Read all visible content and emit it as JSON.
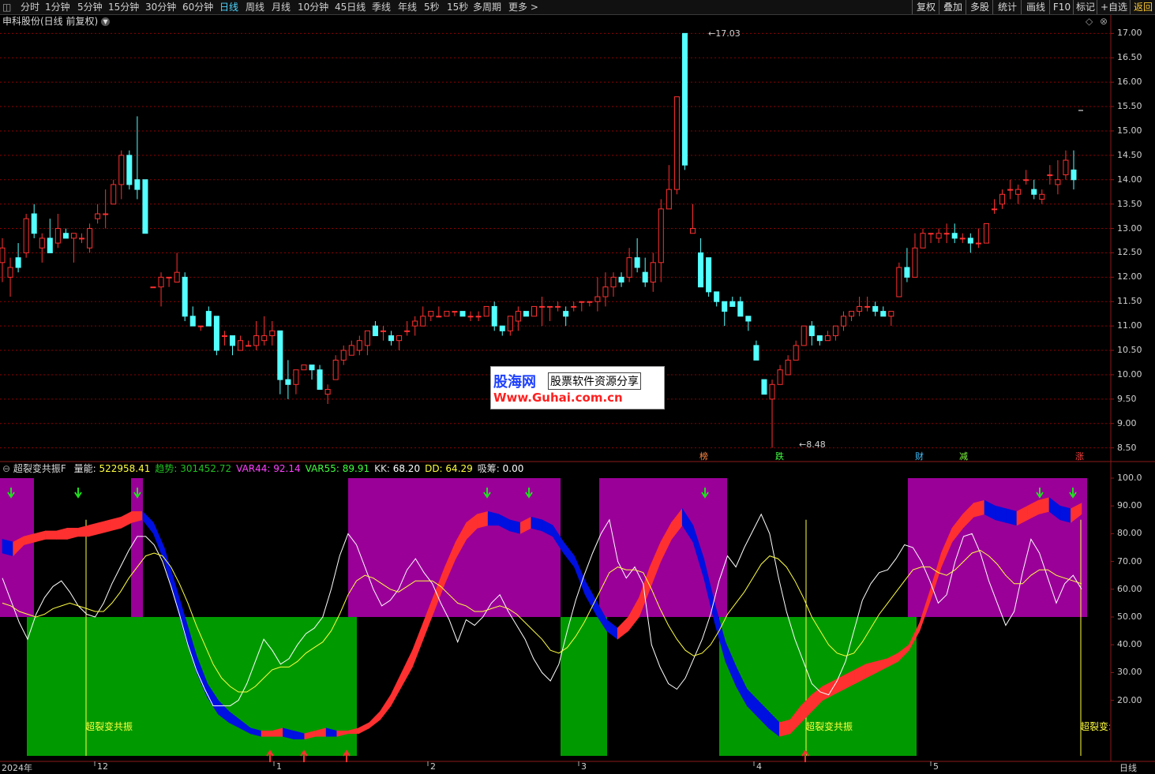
{
  "toolbar": {
    "periods": [
      "分时",
      "1分钟",
      "5分钟",
      "15分钟",
      "30分钟",
      "60分钟",
      "日线",
      "周线",
      "月线",
      "10分钟",
      "45日线",
      "季线",
      "年线",
      "5秒",
      "15秒",
      "多周期",
      "更多 >"
    ],
    "active_period": "日线",
    "right_buttons": [
      "复权",
      "叠加",
      "多股",
      "统计",
      "画线",
      "F10",
      "标记",
      "+自选",
      "返回"
    ]
  },
  "stock": {
    "title": "申科股份(日线 前复权)",
    "high_label": "17.03",
    "low_label": "8.48"
  },
  "price_axis": [
    "17.00",
    "16.50",
    "16.00",
    "15.50",
    "15.00",
    "14.50",
    "14.00",
    "13.50",
    "13.00",
    "12.50",
    "12.00",
    "11.50",
    "11.00",
    "10.50",
    "10.00",
    "9.50",
    "9.00",
    "8.50"
  ],
  "ind_axis": [
    "100.0",
    "90.00",
    "80.00",
    "70.00",
    "60.00",
    "50.00",
    "40.00",
    "30.00",
    "20.00"
  ],
  "indicator": {
    "name": "超裂变共振F",
    "values": [
      {
        "label": "量能:",
        "value": "522958.41",
        "color": "#ffff40"
      },
      {
        "label": "趋势:",
        "value": "301452.72",
        "color": "#20c020"
      },
      {
        "label": "VAR44:",
        "value": "92.14",
        "color": "#ff40ff"
      },
      {
        "label": "VAR55:",
        "value": "89.91",
        "color": "#40ff40"
      },
      {
        "label": "KK:",
        "value": "68.20",
        "color": "#ffffff"
      },
      {
        "label": "DD:",
        "value": "64.29",
        "color": "#ffff40"
      },
      {
        "label": "吸筹:",
        "value": "0.00",
        "color": "#ffffff"
      }
    ],
    "resonance_label": "超裂变共振",
    "resonance_label_cut": "超裂变:"
  },
  "date_axis": {
    "year_label": "2024年",
    "months": [
      "12",
      "1",
      "2",
      "3",
      "4",
      "5"
    ],
    "period": "日线"
  },
  "event_markers": [
    {
      "text": "榜",
      "color": "#ff8844"
    },
    {
      "text": "跌",
      "color": "#40ff40"
    },
    {
      "text": "财",
      "color": "#40c0ff"
    },
    {
      "text": "减",
      "color": "#80ff40"
    },
    {
      "text": "涨",
      "color": "#ff4040"
    }
  ],
  "watermark": {
    "logo": "股海网",
    "slogan": "股票软件资源分享",
    "url": "Www.Guhai.com.cn"
  },
  "colors": {
    "up": "#ff3030",
    "down": "#54ffff",
    "purple": "#9a0098",
    "green": "#009a00",
    "blue": "#0010e0",
    "red": "#ff3030",
    "grid": "#8b0000",
    "axis": "#8b1a1a"
  },
  "chart_data": {
    "type": "candlestick",
    "price_range": [
      8.3,
      17.2
    ],
    "high": 17.03,
    "low": 8.48,
    "ohlc": [
      [
        12.3,
        12.8,
        11.9,
        12.6
      ],
      [
        12.0,
        12.4,
        11.6,
        12.2
      ],
      [
        12.4,
        12.7,
        12.1,
        12.2
      ],
      [
        12.5,
        13.3,
        12.4,
        13.2
      ],
      [
        13.3,
        13.5,
        12.8,
        12.9
      ],
      [
        12.6,
        12.9,
        12.3,
        12.8
      ],
      [
        12.8,
        13.2,
        12.5,
        12.5
      ],
      [
        12.7,
        13.3,
        12.6,
        13.0
      ],
      [
        12.9,
        13.0,
        12.8,
        12.8
      ],
      [
        12.8,
        12.9,
        12.3,
        12.9
      ],
      [
        12.8,
        12.9,
        12.7,
        12.8
      ],
      [
        12.6,
        13.1,
        12.5,
        13.0
      ],
      [
        13.2,
        13.5,
        13.1,
        13.3
      ],
      [
        13.3,
        13.8,
        13.0,
        13.3
      ],
      [
        13.5,
        14.0,
        13.5,
        13.9
      ],
      [
        13.9,
        14.6,
        13.6,
        14.5
      ],
      [
        14.5,
        14.6,
        13.8,
        13.9
      ],
      [
        14.0,
        15.3,
        13.6,
        13.8
      ],
      [
        14.0,
        14.0,
        12.9,
        12.9
      ],
      [
        11.8,
        11.8,
        11.8,
        11.8
      ],
      [
        11.8,
        12.1,
        11.4,
        12.0
      ],
      [
        12.0,
        12.0,
        11.8,
        12.0
      ],
      [
        11.9,
        12.5,
        11.9,
        12.1
      ],
      [
        12.0,
        12.1,
        11.1,
        11.2
      ],
      [
        11.2,
        11.4,
        11.0,
        11.0
      ],
      [
        11.0,
        11.0,
        10.9,
        11.0
      ],
      [
        11.3,
        11.4,
        11.0,
        11.0
      ],
      [
        11.2,
        11.2,
        10.4,
        10.5
      ],
      [
        10.8,
        10.9,
        10.6,
        10.8
      ],
      [
        10.8,
        10.8,
        10.4,
        10.6
      ],
      [
        10.5,
        10.8,
        10.5,
        10.7
      ],
      [
        10.6,
        10.7,
        10.6,
        10.6
      ],
      [
        10.6,
        11.1,
        10.5,
        10.8
      ],
      [
        10.7,
        11.2,
        10.6,
        10.8
      ],
      [
        10.8,
        11.1,
        10.6,
        10.9
      ],
      [
        10.9,
        10.9,
        9.6,
        9.9
      ],
      [
        9.9,
        10.3,
        9.5,
        9.8
      ],
      [
        9.8,
        10.1,
        9.6,
        10.1
      ],
      [
        10.1,
        10.2,
        10.1,
        10.2
      ],
      [
        10.2,
        10.2,
        9.9,
        10.1
      ],
      [
        10.1,
        10.2,
        9.7,
        9.7
      ],
      [
        9.6,
        9.8,
        9.4,
        9.7
      ],
      [
        9.9,
        10.4,
        9.9,
        10.3
      ],
      [
        10.3,
        10.6,
        10.2,
        10.5
      ],
      [
        10.4,
        10.7,
        10.4,
        10.6
      ],
      [
        10.5,
        10.8,
        10.4,
        10.7
      ],
      [
        10.6,
        10.9,
        10.4,
        10.9
      ],
      [
        11.0,
        11.1,
        10.8,
        10.8
      ],
      [
        10.9,
        11.0,
        10.7,
        10.9
      ],
      [
        10.8,
        10.9,
        10.6,
        10.7
      ],
      [
        10.7,
        10.7,
        10.5,
        10.8
      ],
      [
        10.9,
        11.1,
        10.8,
        10.9
      ],
      [
        11.0,
        11.2,
        10.8,
        11.1
      ],
      [
        11.0,
        11.4,
        11.0,
        11.2
      ],
      [
        11.2,
        11.3,
        11.1,
        11.3
      ],
      [
        11.2,
        11.4,
        11.2,
        11.2
      ],
      [
        11.2,
        11.3,
        11.2,
        11.3
      ],
      [
        11.3,
        11.3,
        11.2,
        11.3
      ],
      [
        11.3,
        11.3,
        11.2,
        11.2
      ],
      [
        11.2,
        11.3,
        11.1,
        11.2
      ],
      [
        11.2,
        11.3,
        11.1,
        11.2
      ],
      [
        11.2,
        11.4,
        11.2,
        11.4
      ],
      [
        11.4,
        11.5,
        10.9,
        11.0
      ],
      [
        11.0,
        11.0,
        10.8,
        10.9
      ],
      [
        10.9,
        11.2,
        10.8,
        11.2
      ],
      [
        11.1,
        11.4,
        10.9,
        11.3
      ],
      [
        11.3,
        11.3,
        11.2,
        11.2
      ],
      [
        11.2,
        11.3,
        11.2,
        11.4
      ],
      [
        11.4,
        11.6,
        11.0,
        11.4
      ],
      [
        11.4,
        11.4,
        11.1,
        11.4
      ],
      [
        11.4,
        11.5,
        11.3,
        11.4
      ],
      [
        11.3,
        11.4,
        11.0,
        11.2
      ],
      [
        11.4,
        11.5,
        11.3,
        11.4
      ],
      [
        11.5,
        11.5,
        11.3,
        11.5
      ],
      [
        11.5,
        11.5,
        11.4,
        11.5
      ],
      [
        11.5,
        12.0,
        11.3,
        11.6
      ],
      [
        11.6,
        12.1,
        11.4,
        11.8
      ],
      [
        11.8,
        12.1,
        11.6,
        12.0
      ],
      [
        12.0,
        12.1,
        11.8,
        11.9
      ],
      [
        12.0,
        12.6,
        11.9,
        12.4
      ],
      [
        12.4,
        12.8,
        12.1,
        12.2
      ],
      [
        12.1,
        12.4,
        11.8,
        11.9
      ],
      [
        11.9,
        12.5,
        11.7,
        12.3
      ],
      [
        12.3,
        13.6,
        11.9,
        13.4
      ],
      [
        13.4,
        14.3,
        13.4,
        13.8
      ],
      [
        13.8,
        15.7,
        13.7,
        15.7
      ],
      [
        17.0,
        17.0,
        14.2,
        14.3
      ],
      [
        12.9,
        13.5,
        12.9,
        13.0
      ],
      [
        12.5,
        12.8,
        11.8,
        11.8
      ],
      [
        12.4,
        12.4,
        11.6,
        11.7
      ],
      [
        11.7,
        11.7,
        11.4,
        11.5
      ],
      [
        11.5,
        11.5,
        11.0,
        11.3
      ],
      [
        11.5,
        11.6,
        11.4,
        11.4
      ],
      [
        11.5,
        11.6,
        11.3,
        11.2
      ],
      [
        11.2,
        11.2,
        10.9,
        11.1
      ],
      [
        10.6,
        10.7,
        10.3,
        10.3
      ],
      [
        9.9,
        9.9,
        9.6,
        9.6
      ],
      [
        9.5,
        9.9,
        8.5,
        9.8
      ],
      [
        9.8,
        10.2,
        9.8,
        10.1
      ],
      [
        10.0,
        10.4,
        10.0,
        10.3
      ],
      [
        10.3,
        10.7,
        10.3,
        10.6
      ],
      [
        10.6,
        10.9,
        10.6,
        11.0
      ],
      [
        11.0,
        11.1,
        10.6,
        10.8
      ],
      [
        10.8,
        10.8,
        10.6,
        10.7
      ],
      [
        10.7,
        10.9,
        10.7,
        10.8
      ],
      [
        10.8,
        11.0,
        10.7,
        11.0
      ],
      [
        11.0,
        11.3,
        10.9,
        11.2
      ],
      [
        11.2,
        11.3,
        11.1,
        11.3
      ],
      [
        11.3,
        11.6,
        11.2,
        11.4
      ],
      [
        11.4,
        11.6,
        11.3,
        11.4
      ],
      [
        11.4,
        11.5,
        11.2,
        11.3
      ],
      [
        11.3,
        11.4,
        11.2,
        11.2
      ],
      [
        11.2,
        11.3,
        11.0,
        11.3
      ],
      [
        11.6,
        12.3,
        11.6,
        12.2
      ],
      [
        12.2,
        12.6,
        11.9,
        12.0
      ],
      [
        12.0,
        12.9,
        12.0,
        12.6
      ],
      [
        12.6,
        13.0,
        12.6,
        12.9
      ],
      [
        12.9,
        12.9,
        12.7,
        12.9
      ],
      [
        12.8,
        13.0,
        12.7,
        12.9
      ],
      [
        12.9,
        13.1,
        12.7,
        12.9
      ],
      [
        12.9,
        13.1,
        12.7,
        12.8
      ],
      [
        12.8,
        12.9,
        12.7,
        12.8
      ],
      [
        12.8,
        12.9,
        12.5,
        12.7
      ],
      [
        12.7,
        13.0,
        12.6,
        12.7
      ],
      [
        12.7,
        13.1,
        12.7,
        13.1
      ],
      [
        13.4,
        13.6,
        13.3,
        13.4
      ],
      [
        13.5,
        13.8,
        13.4,
        13.7
      ],
      [
        13.8,
        14.0,
        13.6,
        13.8
      ],
      [
        13.7,
        13.9,
        13.5,
        13.8
      ],
      [
        14.0,
        14.2,
        13.9,
        14.0
      ],
      [
        13.8,
        14.0,
        13.6,
        13.7
      ],
      [
        13.6,
        13.8,
        13.5,
        13.7
      ],
      [
        14.1,
        14.3,
        13.9,
        14.1
      ],
      [
        13.9,
        14.4,
        13.7,
        14.0
      ],
      [
        14.1,
        14.6,
        14.0,
        14.4
      ],
      [
        14.2,
        14.6,
        13.8,
        14.0
      ]
    ],
    "indicator_range": [
      0,
      100
    ],
    "kk": [
      64,
      56,
      48,
      42,
      51,
      57,
      61,
      63,
      59,
      54,
      51,
      50,
      55,
      62,
      68,
      74,
      79,
      79,
      76,
      70,
      61,
      51,
      40,
      31,
      24,
      18,
      18,
      18,
      20,
      26,
      34,
      42,
      38,
      33,
      35,
      40,
      44,
      46,
      50,
      60,
      72,
      80,
      76,
      68,
      60,
      54,
      56,
      60,
      67,
      71,
      66,
      62,
      55,
      49,
      41,
      49,
      47,
      50,
      55,
      58,
      52,
      47,
      42,
      35,
      30,
      27,
      33,
      45,
      56,
      65,
      73,
      80,
      85,
      70,
      64,
      68,
      62,
      40,
      32,
      26,
      24,
      28,
      35,
      42,
      51,
      63,
      72,
      68,
      75,
      81,
      87,
      80,
      65,
      52,
      42,
      34,
      26,
      23,
      22,
      27,
      34,
      45,
      56,
      62,
      66,
      67,
      71,
      76,
      75,
      70,
      63,
      55,
      58,
      70,
      79,
      80,
      73,
      63,
      55,
      47,
      52,
      66,
      78,
      73,
      64,
      55,
      62,
      65,
      60
    ],
    "dd": [
      55,
      54,
      52,
      51,
      50,
      51,
      53,
      54,
      55,
      54,
      53,
      52,
      52,
      55,
      59,
      64,
      68,
      72,
      73,
      72,
      68,
      62,
      55,
      47,
      40,
      33,
      28,
      25,
      23,
      23,
      25,
      28,
      31,
      32,
      32,
      34,
      37,
      39,
      41,
      45,
      51,
      58,
      63,
      65,
      64,
      62,
      60,
      59,
      61,
      63,
      63,
      63,
      61,
      58,
      55,
      54,
      52,
      52,
      53,
      54,
      53,
      51,
      48,
      45,
      42,
      38,
      37,
      39,
      43,
      48,
      54,
      60,
      66,
      68,
      67,
      67,
      66,
      60,
      53,
      47,
      42,
      38,
      36,
      37,
      40,
      45,
      51,
      55,
      59,
      64,
      69,
      72,
      71,
      68,
      63,
      57,
      50,
      45,
      40,
      37,
      36,
      37,
      41,
      46,
      51,
      55,
      59,
      63,
      67,
      68,
      68,
      66,
      65,
      67,
      70,
      73,
      74,
      72,
      69,
      65,
      62,
      62,
      65,
      67,
      67,
      65,
      64,
      63,
      62
    ],
    "band_top": [
      78,
      77,
      79,
      80,
      81,
      81,
      82,
      82,
      83,
      84,
      85,
      86,
      88,
      88,
      84,
      75,
      62,
      49,
      36,
      26,
      20,
      16,
      13,
      10,
      9,
      9,
      10,
      9,
      8,
      9,
      10,
      9,
      9,
      10,
      12,
      16,
      22,
      30,
      38,
      48,
      58,
      68,
      77,
      84,
      87,
      88,
      87,
      85,
      84,
      86,
      85,
      83,
      77,
      72,
      63,
      56,
      49,
      46,
      50,
      57,
      68,
      77,
      84,
      89,
      83,
      71,
      55,
      41,
      32,
      24,
      20,
      16,
      12,
      13,
      18,
      22,
      25,
      27,
      29,
      31,
      33,
      34,
      35,
      37,
      40,
      48,
      60,
      73,
      82,
      87,
      91,
      92,
      90,
      89,
      88,
      90,
      92,
      93,
      90,
      89,
      91
    ],
    "band_bot": [
      73,
      72,
      76,
      77,
      78,
      78,
      78,
      79,
      79,
      80,
      81,
      82,
      84,
      85,
      80,
      70,
      56,
      42,
      30,
      21,
      15,
      12,
      10,
      8,
      7,
      7,
      7,
      6,
      6,
      7,
      7,
      7,
      8,
      8,
      10,
      13,
      18,
      25,
      32,
      42,
      52,
      62,
      71,
      78,
      82,
      83,
      83,
      81,
      80,
      82,
      81,
      79,
      73,
      68,
      58,
      51,
      45,
      42,
      45,
      50,
      60,
      70,
      78,
      83,
      77,
      64,
      48,
      34,
      25,
      18,
      14,
      10,
      7,
      8,
      12,
      16,
      20,
      22,
      24,
      26,
      28,
      30,
      32,
      34,
      38,
      45,
      56,
      68,
      77,
      82,
      86,
      87,
      85,
      84,
      83,
      85,
      87,
      88,
      85,
      84,
      87
    ]
  }
}
